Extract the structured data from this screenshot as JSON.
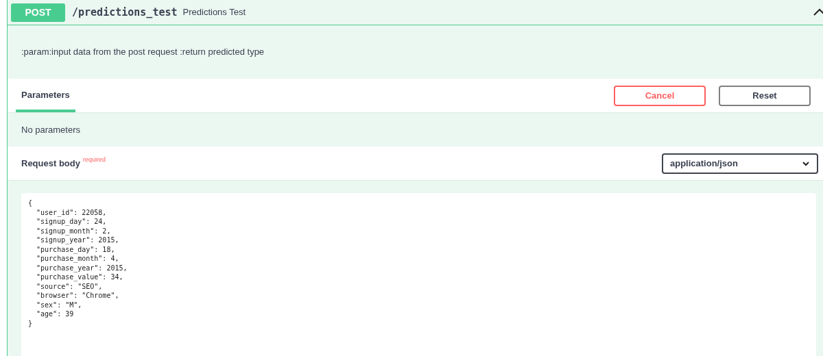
{
  "operation": {
    "method": "POST",
    "path": "/predictions_test",
    "summary": "Predictions Test",
    "expanded": true
  },
  "description": ":param:input data from the post request :return predicted type",
  "tabs": [
    {
      "label": "Parameters",
      "selected": true
    }
  ],
  "buttons": [
    {
      "label": "Cancel",
      "kind": "danger"
    },
    {
      "label": "Reset",
      "kind": "plain"
    }
  ],
  "parameters_message": "No parameters",
  "request_body": {
    "title": "Request body",
    "required_label": "required",
    "content_type": "application/json",
    "value": "{\n  \"user_id\": 22058,\n  \"signup_day\": 24,\n  \"signup_month\": 2,\n  \"signup_year\": 2015,\n  \"purchase_day\": 18,\n  \"purchase_month\": 4,\n  \"purchase_year\": 2015,\n  \"purchase_value\": 34,\n  \"source\": \"SEO\",\n  \"browser\": \"Chrome\",\n  \"sex\": \"M\",\n  \"age\": 39\n}"
  }
}
